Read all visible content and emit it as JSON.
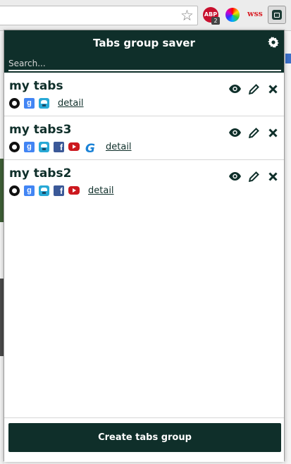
{
  "browser": {
    "abp_label": "ABP",
    "abp_count": "2",
    "wss_label": "wss"
  },
  "popup": {
    "title": "Tabs group saver",
    "search_placeholder": "Search...",
    "create_button_label": "Create tabs group"
  },
  "groups": [
    {
      "name": "my tabs",
      "icons": [
        "github-icon",
        "google-icon",
        "messenger-icon"
      ],
      "detail_label": "detail"
    },
    {
      "name": "my tabs3",
      "icons": [
        "github-icon",
        "google-icon",
        "messenger-icon",
        "facebook-icon",
        "youtube-icon",
        "g-logo-icon"
      ],
      "detail_label": "detail"
    },
    {
      "name": "my tabs2",
      "icons": [
        "github-icon",
        "google-icon",
        "messenger-icon",
        "facebook-icon",
        "youtube-icon"
      ],
      "detail_label": "detail"
    }
  ],
  "colors": {
    "header": "#0f2f2a",
    "button": "#0f2f2a",
    "text": "#0f2f2a"
  }
}
